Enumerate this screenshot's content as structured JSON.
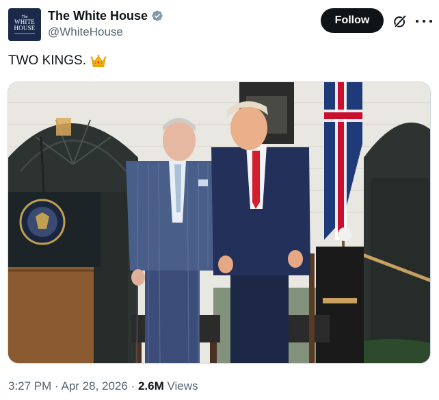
{
  "account": {
    "avatar_text": {
      "top": "The",
      "line1": "WHITE",
      "line2": "HOUSE"
    },
    "display_name": "The White House",
    "handle": "@WhiteHouse",
    "verified_badge": "verified-gray-badge",
    "verified_color": "#829aab"
  },
  "actions": {
    "follow_label": "Follow",
    "grok_icon": "grok-icon",
    "more_icon": "more-icon"
  },
  "post": {
    "text": "TWO KINGS.",
    "emoji": "crown-icon"
  },
  "media": {
    "kind": "photo"
  },
  "meta": {
    "time": "3:27 PM",
    "sep1": " · ",
    "date": "Apr 28, 2026",
    "sep2": " · ",
    "views_count": "2.6M",
    "views_label": " Views"
  },
  "colors": {
    "text": "#0f1419",
    "secondary": "#536471",
    "follow_bg": "#0f1419",
    "border": "#cfd9de"
  }
}
